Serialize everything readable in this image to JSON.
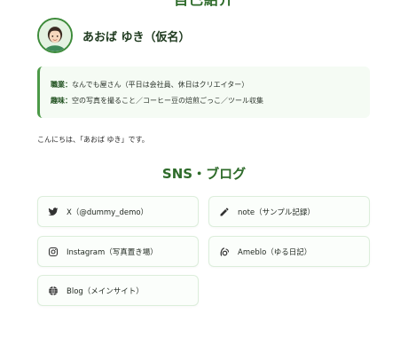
{
  "header": {
    "section_title": "自己紹介"
  },
  "profile": {
    "name": "あおば ゆき（仮名）"
  },
  "info": {
    "rows": [
      {
        "key": "職業：",
        "value": "なんでも屋さん（平日は会社員、休日はクリエイター）"
      },
      {
        "key": "趣味：",
        "value": "空の写真を撮ること／コーヒー豆の焙煎ごっこ／ツール収集"
      }
    ]
  },
  "greeting": "こんにちは、「あおば ゆき」です。",
  "sns": {
    "title": "SNS・ブログ",
    "links": [
      {
        "label": "X（@dummy_demo）",
        "icon": "twitter-bird-icon"
      },
      {
        "label": "note（サンプル記録）",
        "icon": "pencil-icon"
      },
      {
        "label": "Instagram（写真置き場）",
        "icon": "instagram-icon"
      },
      {
        "label": "Ameblo（ゆる日記）",
        "icon": "ameblo-icon"
      },
      {
        "label": "Blog（メインサイト）",
        "icon": "globe-icon"
      }
    ]
  },
  "colors": {
    "accent": "#2e6b2a",
    "box_bg": "#f5fbf4",
    "border": "#dceedb"
  }
}
